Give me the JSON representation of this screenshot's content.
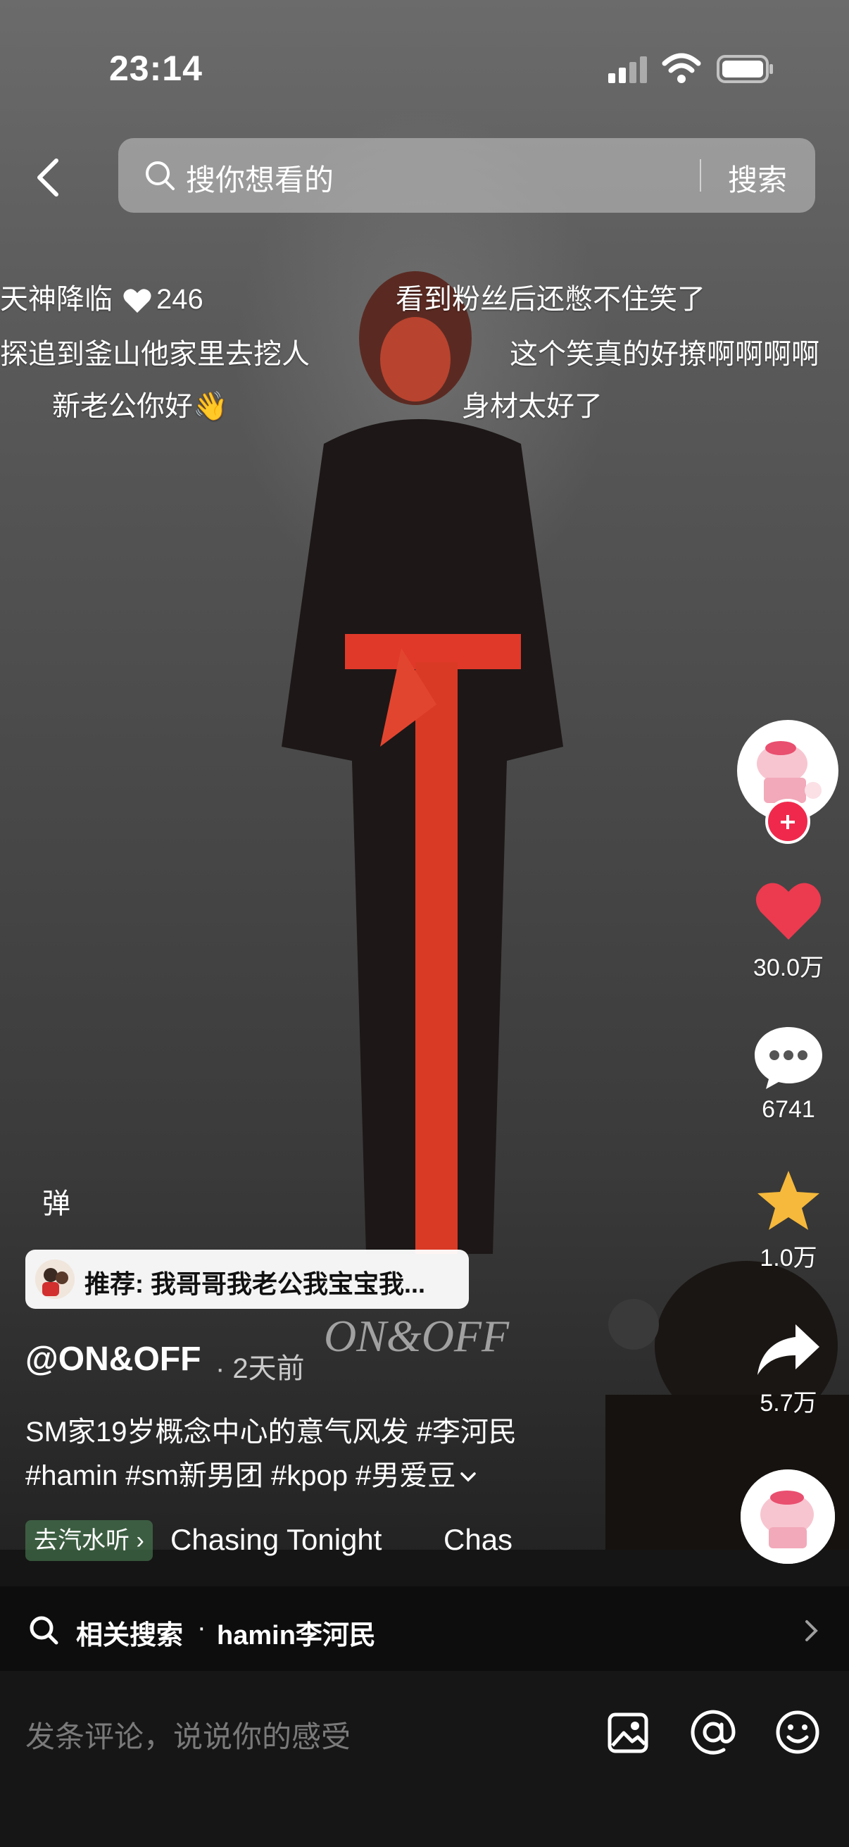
{
  "status_bar": {
    "time": "23:14"
  },
  "search": {
    "placeholder": "搜你想看的",
    "button_label": "搜索"
  },
  "danmaku": [
    {
      "text": "天神降临",
      "likes": "246"
    },
    {
      "text": "看到粉丝后还憋不住笑了"
    },
    {
      "text": "探追到釜山他家里去挖人"
    },
    {
      "text": "这个笑真的好撩啊啊啊啊"
    },
    {
      "text": "新老公你好👋"
    },
    {
      "text": "身材太好了"
    }
  ],
  "video_overlay_text": "ON&OFF",
  "actions": {
    "likes": "30.0万",
    "comments": "6741",
    "favorites": "1.0万",
    "shares": "5.7万"
  },
  "danmaku_toggle": "弹",
  "recommend": {
    "text": "推荐: 我哥哥我老公我宝宝我..."
  },
  "post": {
    "author": "@ON&OFF",
    "time": "· 2天前",
    "caption_line1": "SM家19岁概念中心的意气风发 #李河民",
    "caption_line2": "#hamin #sm新男团 #kpop #男爱豆"
  },
  "music": {
    "qishui_label": "去汽水听 ›",
    "song_title": "Chasing Tonight",
    "song_title_repeat": "Chas"
  },
  "related": {
    "label": "相关搜索",
    "dot": "·",
    "term": "hamin李河民"
  },
  "comment": {
    "placeholder": "发条评论，说说你的感受"
  },
  "colors": {
    "like_red": "#ec3a4f",
    "star_yellow": "#f6b93b",
    "follow_red": "#f0294c"
  }
}
